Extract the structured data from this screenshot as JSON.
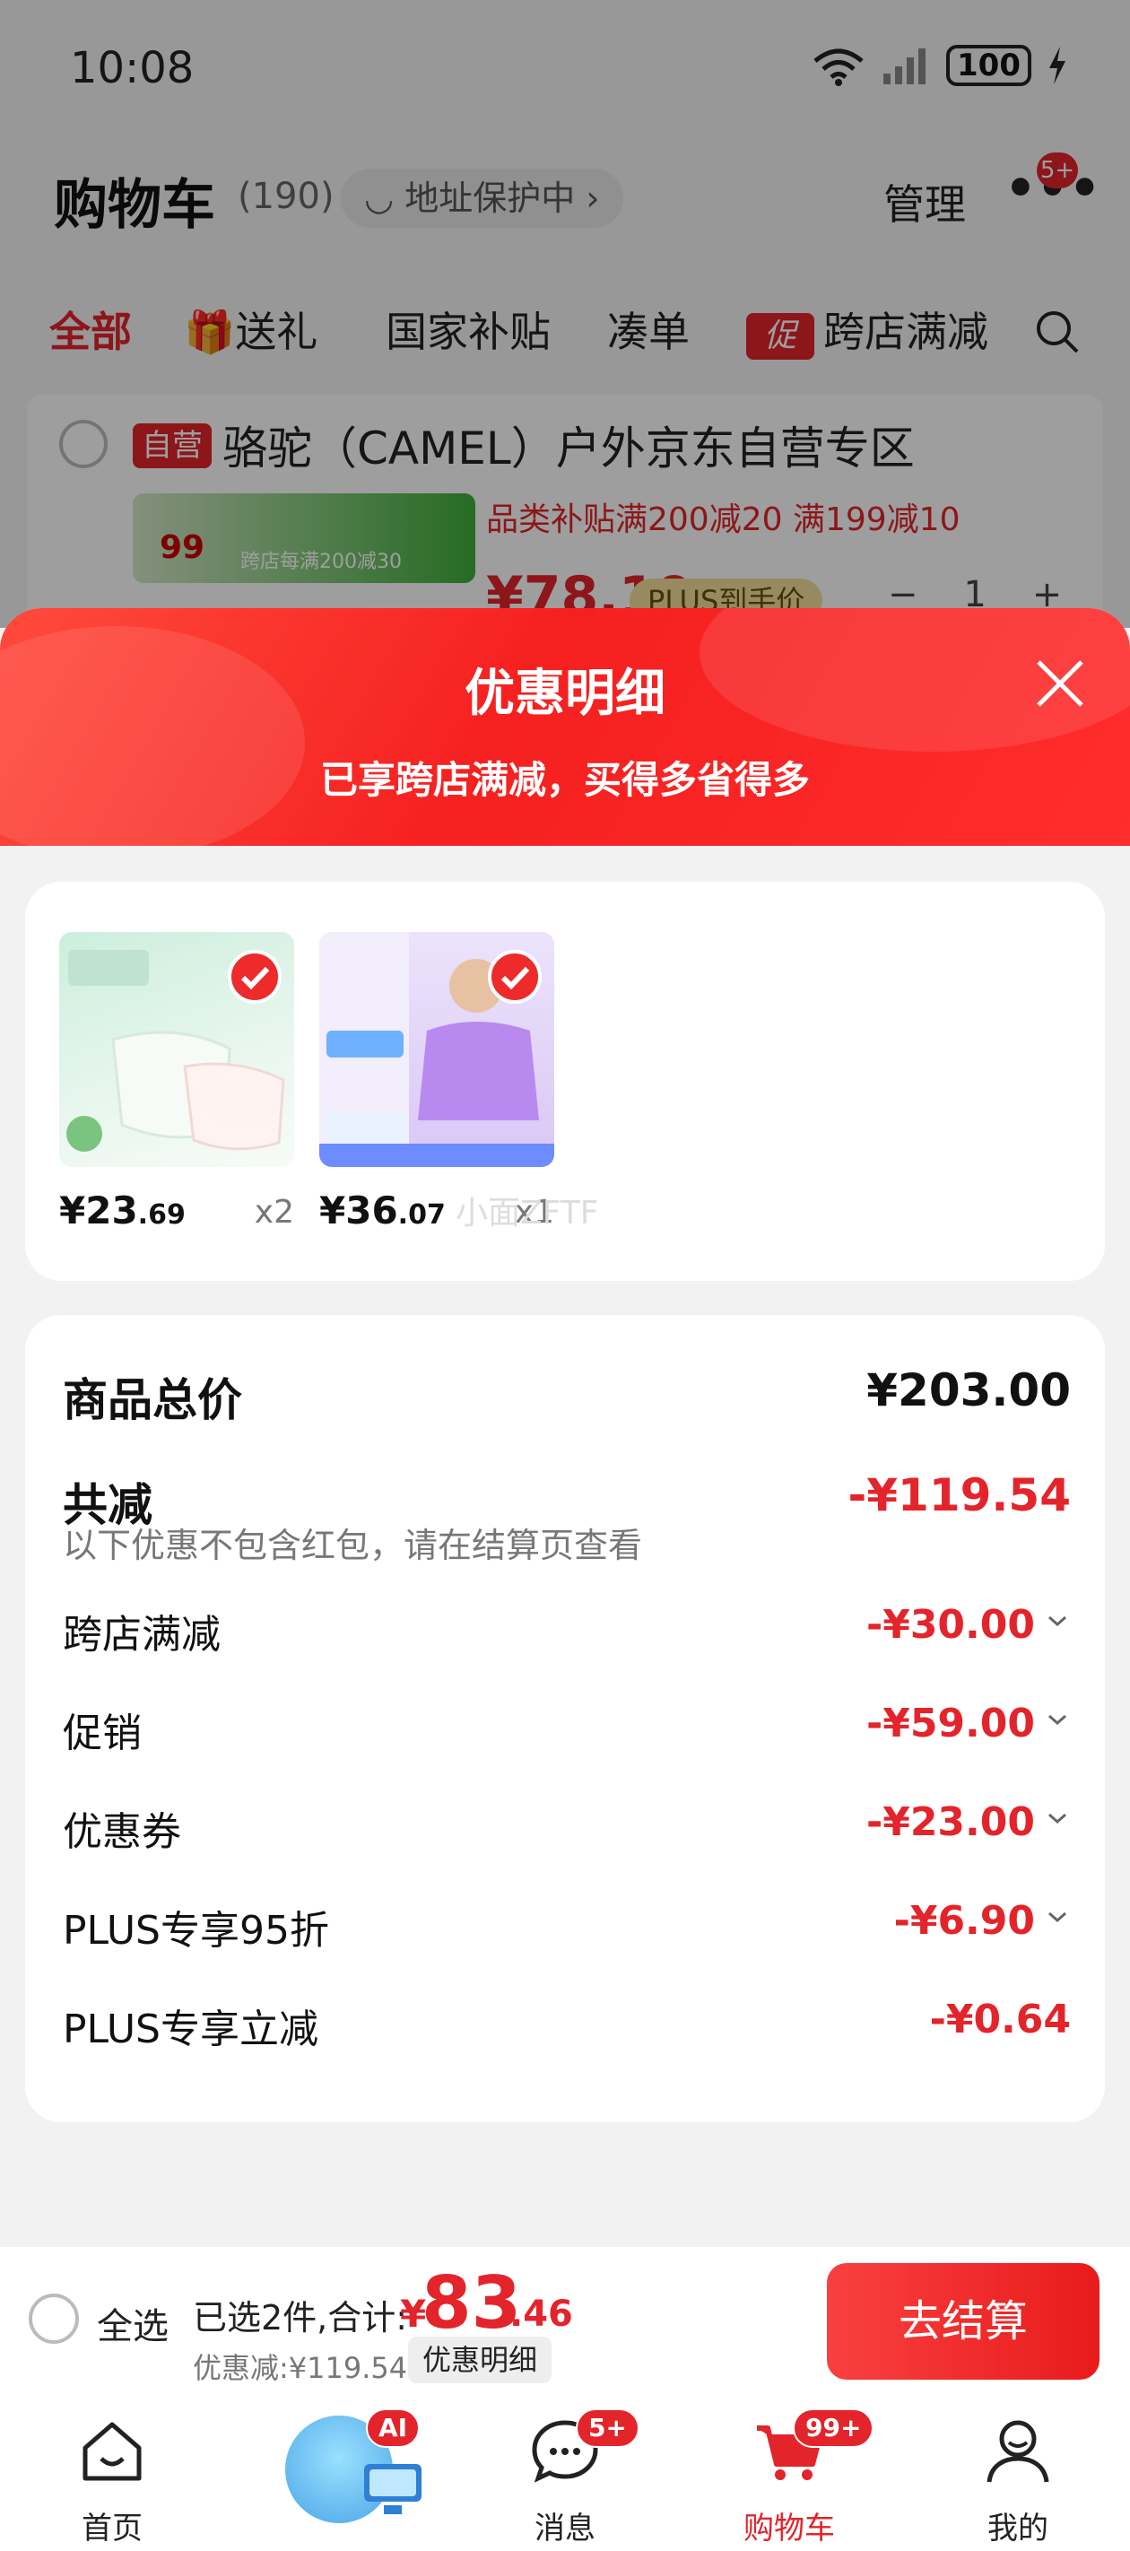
{
  "status": {
    "time": "10:08",
    "battery": "100",
    "network": "6"
  },
  "cart": {
    "title": "购物车",
    "count": "(190)",
    "address_pill": "地址保护中",
    "manage": "管理",
    "more_badge": "5+"
  },
  "tabs": [
    {
      "label": "全部"
    },
    {
      "label": "送礼"
    },
    {
      "label": "国家补贴"
    },
    {
      "label": "凑单"
    },
    {
      "label": "跨店满减",
      "chip": "促"
    }
  ],
  "store": {
    "tag": "自营",
    "name": "骆驼（CAMEL）户外京东自营专区",
    "thumb_price": "99",
    "thumb_text": "跨店每满200减30",
    "subsidy": "品类补贴满200减20  满199减10",
    "price": "¥78.19",
    "plus_tag": "PLUS到手价",
    "qty": "1"
  },
  "sheet": {
    "title": "优惠明细",
    "subtitle": "已享跨店满减，买得多省得多",
    "items": [
      {
        "price_int": "¥23",
        "price_dec": ".69",
        "qty": "x2"
      },
      {
        "price_int": "¥36",
        "price_dec": ".07",
        "qty": "x1"
      }
    ],
    "watermark": "小面ZFTF",
    "summary": {
      "total_label": "商品总价",
      "total_value": "¥203.00",
      "reduce_label": "共减",
      "reduce_value": "-¥119.54",
      "note": "以下优惠不包含红包，请在结算页查看",
      "lines": [
        {
          "label": "跨店满减",
          "value": "-¥30.00"
        },
        {
          "label": "促销",
          "value": "-¥59.00"
        },
        {
          "label": "优惠券",
          "value": "-¥23.00"
        },
        {
          "label": "PLUS专享95折",
          "value": "-¥6.90"
        },
        {
          "label": "PLUS专享立减",
          "value": "-¥0.64"
        }
      ]
    }
  },
  "checkout": {
    "select_all": "全选",
    "selected": "已选2件,合计:",
    "yen": "¥",
    "total_int": "83",
    "total_dec": ".46",
    "saved": "优惠减:¥119.54",
    "detail_chip": "优惠明细",
    "button": "去结算"
  },
  "nav": [
    {
      "label": "首页"
    },
    {
      "label": "",
      "badge": "AI"
    },
    {
      "label": "消息",
      "badge": "5+"
    },
    {
      "label": "购物车",
      "badge": "99+"
    },
    {
      "label": "我的"
    }
  ],
  "colors": {
    "accent": "#e3242b",
    "sheet_header": "#f52020"
  }
}
